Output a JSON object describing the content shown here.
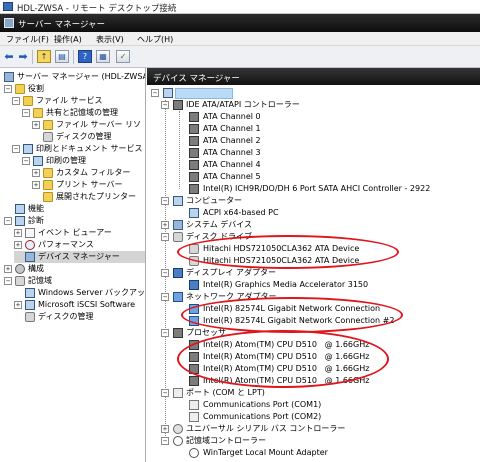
{
  "rdp": {
    "title": "HDL-ZWSA - リモート デスクトップ接続"
  },
  "window": {
    "title": "サーバー マネージャー"
  },
  "menu": [
    "ファイル(F)",
    "操作(A)",
    "表示(V)",
    "ヘルプ(H)"
  ],
  "left_tree": [
    {
      "label": "サーバー マネージャー (HDL-ZWSA",
      "icon": "server-manager-icon"
    },
    {
      "label": "役割",
      "icon": "roles-icon"
    },
    {
      "label": "ファイル サービス",
      "icon": "folder-icon"
    },
    {
      "label": "共有と記憶域の管理",
      "icon": "share-icon"
    },
    {
      "label": "ファイル サーバー リソ",
      "icon": "folder-icon"
    },
    {
      "label": "ディスクの管理",
      "icon": "disk-icon"
    },
    {
      "label": "印刷とドキュメント サービス",
      "icon": "printer-icon"
    },
    {
      "label": "印刷の管理",
      "icon": "printer-icon"
    },
    {
      "label": "カスタム フィルター",
      "icon": "folder-icon"
    },
    {
      "label": "プリント サーバー",
      "icon": "folder-icon"
    },
    {
      "label": "展開されたプリンター",
      "icon": "folder-icon"
    },
    {
      "label": "機能",
      "icon": "features-icon"
    },
    {
      "label": "診断",
      "icon": "diagnostics-icon"
    },
    {
      "label": "イベント ビューアー",
      "icon": "event-viewer-icon"
    },
    {
      "label": "パフォーマンス",
      "icon": "performance-icon"
    },
    {
      "label": "デバイス マネージャー",
      "icon": "device-manager-icon"
    },
    {
      "label": "構成",
      "icon": "configuration-icon"
    },
    {
      "label": "記憶域",
      "icon": "storage-icon"
    },
    {
      "label": "Windows Server バックアップ",
      "icon": "backup-icon"
    },
    {
      "label": "Microsoft iSCSI Software",
      "icon": "iscsi-icon"
    },
    {
      "label": "ディスクの管理",
      "icon": "disk-icon"
    }
  ],
  "device_manager": {
    "header": "デバイス マネージャー",
    "categories": [
      {
        "label": "IDE ATA/ATAPI コントローラー",
        "icon": "ide-controller-icon",
        "devices": [
          "ATA Channel 0",
          "ATA Channel 1",
          "ATA Channel 2",
          "ATA Channel 3",
          "ATA Channel 4",
          "ATA Channel 5",
          "Intel(R) ICH9R/DO/DH 6 Port SATA AHCI Controller - 2922"
        ]
      },
      {
        "label": "コンピューター",
        "icon": "computer-icon",
        "devices": [
          "ACPI x64-based PC"
        ]
      },
      {
        "label": "システム デバイス",
        "icon": "system-devices-icon",
        "devices": []
      },
      {
        "label": "ディスク ドライブ",
        "icon": "disk-drive-icon",
        "devices": [
          "Hitachi HDS721050CLA362 ATA Device",
          "Hitachi HDS721050CLA362 ATA Device"
        ]
      },
      {
        "label": "ディスプレイ アダプター",
        "icon": "display-adapter-icon",
        "devices": [
          "Intel(R) Graphics Media Accelerator 3150"
        ]
      },
      {
        "label": "ネットワーク アダプター",
        "icon": "network-adapter-icon",
        "devices": [
          "Intel(R) 82574L Gigabit Network Connection",
          "Intel(R) 82574L Gigabit Network Connection #2"
        ]
      },
      {
        "label": "プロセッサ",
        "icon": "processor-icon",
        "devices": [
          "Intel(R) Atom(TM) CPU D510   @ 1.66GHz",
          "Intel(R) Atom(TM) CPU D510   @ 1.66GHz",
          "Intel(R) Atom(TM) CPU D510   @ 1.66GHz",
          "Intel(R) Atom(TM) CPU D510   @ 1.66GHz"
        ]
      },
      {
        "label": "ポート (COM と LPT)",
        "icon": "port-icon",
        "devices": [
          "Communications Port (COM1)",
          "Communications Port (COM2)"
        ]
      },
      {
        "label": "ユニバーサル シリアル バス コントローラー",
        "icon": "usb-icon",
        "devices": []
      },
      {
        "label": "記憶域コントローラー",
        "icon": "storage-controller-icon",
        "devices": [
          "WinTarget Local Mount Adapter"
        ]
      }
    ]
  },
  "annotation_color": "#e0141b"
}
